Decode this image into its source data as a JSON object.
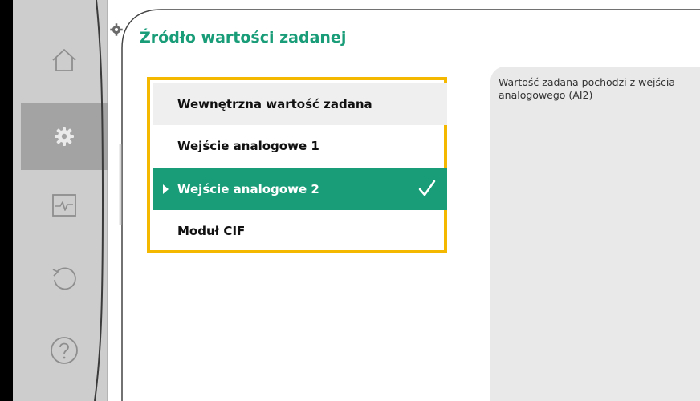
{
  "sidebar": {
    "items": [
      {
        "icon": "home-icon"
      },
      {
        "icon": "gear-icon",
        "active": true
      },
      {
        "icon": "diagnostics-icon"
      },
      {
        "icon": "undo-icon"
      },
      {
        "icon": "help-icon"
      }
    ]
  },
  "page": {
    "title": "Źródło wartości zadanej"
  },
  "menu": {
    "items": [
      {
        "label": "Wewnętrzna wartość zadana"
      },
      {
        "label": "Wejście analogowe 1"
      },
      {
        "label": "Wejście analogowe 2",
        "selected": true
      },
      {
        "label": "Moduł CIF"
      }
    ]
  },
  "info": {
    "text": "Wartość zadana pochodzi z wejścia analogowego (AI2)"
  },
  "colors": {
    "accent": "#199c78",
    "focus_frame": "#f5b800",
    "sidebar": "#cdcdcd",
    "sidebar_active": "#a3a3a3"
  }
}
